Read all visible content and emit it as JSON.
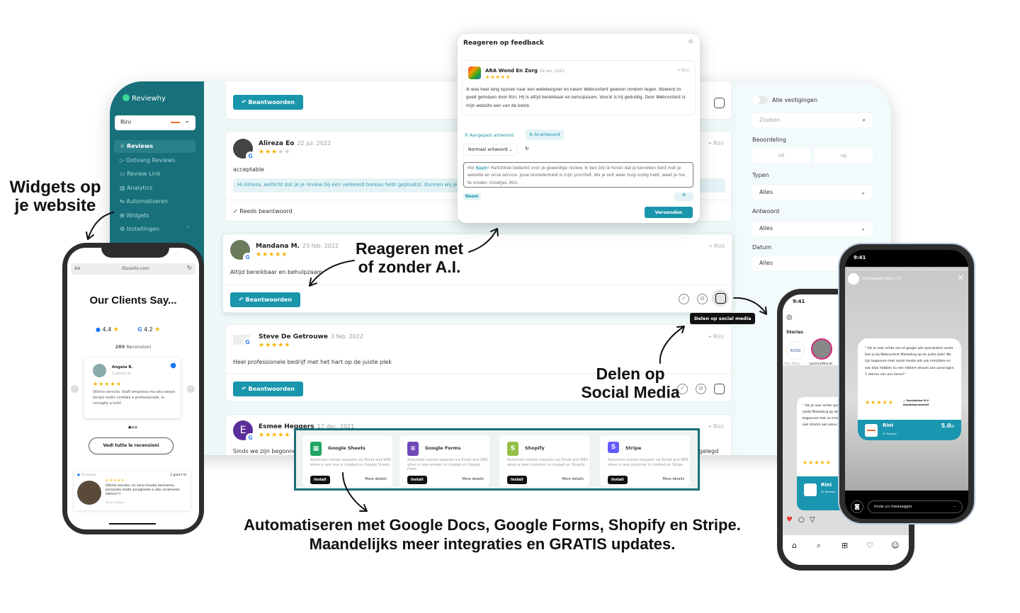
{
  "annotations": {
    "widgets": [
      "Widgets op",
      "je website"
    ],
    "ai": [
      "Reageren met",
      "of zonder A.I."
    ],
    "social": [
      "Delen op",
      "Social Media"
    ],
    "bottom": [
      "Automatiseren met Google Docs, Google Forms, Shopify en Stripe.",
      "Maandelijks meer integraties en GRATIS updates."
    ]
  },
  "sidebar": {
    "logo": "Reviewhy",
    "location": "Rini",
    "items": [
      {
        "label": "Reviews",
        "icon": "star-icon"
      },
      {
        "label": "Ontvang Reviews",
        "icon": "send-icon"
      },
      {
        "label": "Review Link",
        "icon": "monitor-icon"
      },
      {
        "label": "Analytics",
        "icon": "chart-icon"
      },
      {
        "label": "Automatiseren",
        "icon": "automation-icon"
      },
      {
        "label": "Widgets",
        "icon": "widgets-icon"
      },
      {
        "label": "Instellingen",
        "icon": "gear-icon"
      }
    ]
  },
  "reviews": {
    "reply_label": "Beantwoorden",
    "answered_label": "Reeds beantwoord",
    "location": "Rini",
    "items": [
      {
        "name": "Alireza Eo",
        "date": "22 jul. 2022",
        "rating": 3,
        "text": "acceptable",
        "reply": "Hi Alireza, wellicht dat je je review bij een verkeerd bureau hebt geplaatst. Kunnen wij je h"
      },
      {
        "name": "Mandana M.",
        "date": "23 feb. 2022",
        "rating": 5,
        "text": "Altijd bereikbaar en behulpzaam"
      },
      {
        "name": "Steve De Getrouwe",
        "date": "3 feb. 2022",
        "rating": 5,
        "text": "Heel professionele bedrijf met het hart op de juiste plek"
      },
      {
        "name": "Esmee Heggers",
        "date": "17 dec. 2021",
        "rating": 5,
        "text": "Sinds we zijn begonnen",
        "text_tail": "gelegd"
      }
    ]
  },
  "tooltip": "Delen op social media",
  "filters": {
    "all_locations": "Alle vestigingen",
    "search_placeholder": "Zoeken",
    "rating_label": "Beoordeling",
    "type_label": "Typen",
    "type_value": "Alles",
    "answer_label": "Antwoord",
    "answer_value": "Alles",
    "date_label": "Datum",
    "date_value": "Alles"
  },
  "modal": {
    "title": "Reageren op feedback",
    "reviewer": "ARA Wond En Zorg",
    "date": "19 okt. 2021",
    "rating": 5,
    "location": "Rini",
    "text": "Ik was heel lang opzoek naar een webdesigner en kwam Webcontent gewoon rondom tegen. Ikbwerd zo goed geholpen door Rini. Hij is altijd bereikbaar en behulpzaam. Vooral is hij geduldig. Door Webcontent is mijn website een van de beste.",
    "tab_custom": "Aangepast antwoord",
    "tab_ai": "AI-antwoord",
    "tone": "Normaal antwoord",
    "reply_prefix": "Hoi",
    "reply_tag": "Naam",
    "reply_text": "! Hartstikke bedankt voor je geweldige review. Ik ben blij te horen dat je tevreden bent met je website en onze service. Jouw tevredenheid is mijn prioriteit. Als je ooit weer hulp nodig hebt, weet je me te vinden. Groetjes, Rini.",
    "chip": "Naam",
    "send": "Verzenden"
  },
  "widget_phone": {
    "url": "iltuosito.com",
    "aa": "AA",
    "heading": "Our Clients Say...",
    "fb_score": "4.4",
    "g_score": "4.2",
    "count": "289",
    "count_label": "Recensioni",
    "reviewer": "Angela B.",
    "ago": "2 giorno fa",
    "text": "Ottimo servizio. Staff simpatico ma allo stesso tempo molto cordiale e professionale, lo consiglio a tutti!",
    "all_button": "Vedi tutte le recensioni",
    "fb_source": "Facebook",
    "fb_ago": "2 giorni fa",
    "fb_text": "Ottimo servizio, mi sono trovato benissimo, personale molto accogliente e cibo veramente ottimo!!!!",
    "fb_author": "Silvia Carboni"
  },
  "insta_phone": {
    "time": "9:41",
    "stories": "Stories",
    "your_story": "Your Story",
    "user": "parzivalthecat",
    "brand": "ROSSI",
    "quote": "\" Als je naar echte specialisten zoekt Marketing op de ju begonnen met so inmiddels en ook stroom aan aanvr heren!\"",
    "name": "Rini",
    "count": "23 Reviews"
  },
  "story_phone": {
    "time": "9:41",
    "account": "Fisioterapia Rossi",
    "age": "23h",
    "quote": "\" Als je naar echte seo of google ads specialisten zoekt ben je bij Webcontent Marketing op de juiste plek! We zijn begonnen met social media ads ook inmiddels en ook daar hebben nu een lekkere stroom aan aanvragen. 5 sterren van ons heren!\"",
    "author": "Duckdekker B.V.",
    "author_sub": "Dakdekkersbedrijf",
    "name": "Rini",
    "count": "23 Reviews",
    "score": "5.0",
    "score_max": "/5",
    "message_placeholder": "Invia un messaggio"
  },
  "integrations": [
    {
      "name": "Google Sheets",
      "desc": "Automate review requests via Email and SMS when a new row is created on Google Sheets.",
      "color": "#1fa463",
      "glyph": "▦"
    },
    {
      "name": "Google Forms",
      "desc": "Automate review requests via Email and SMS when a new answer is created on Google Form.",
      "color": "#7248b9",
      "glyph": "≡"
    },
    {
      "name": "Shopify",
      "desc": "Automate review requests via Email and SMS when a new customer is created on Shopify.",
      "color": "#95bf47",
      "glyph": "S"
    },
    {
      "name": "Stripe",
      "desc": "Automate review requests via Email and SMS when a new customer is created on Stripe.",
      "color": "#635bff",
      "glyph": "S"
    }
  ],
  "integration_install": "Install",
  "integration_more": "More details",
  "colors": {
    "teal": "#17707a",
    "accent": "#1996ac",
    "star": "#f6b400",
    "orange": "#f26b2a"
  }
}
